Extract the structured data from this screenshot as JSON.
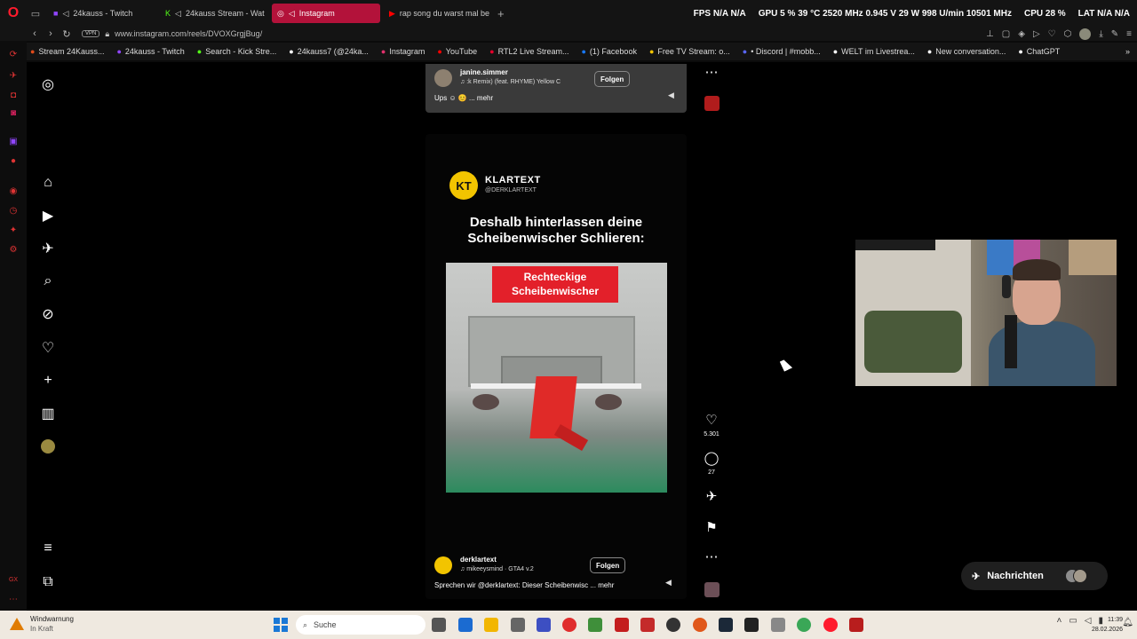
{
  "browser": {
    "tabs": [
      {
        "label": "24kauss - Twitch",
        "icon": "twitch-icon",
        "active": false
      },
      {
        "label": "24kauss Stream - Wat",
        "icon": "kick-icon",
        "active": false
      },
      {
        "label": "Instagram",
        "icon": "instagram-icon",
        "active": true
      },
      {
        "label": "rap song du warst mal be",
        "icon": "youtube-icon",
        "active": false
      }
    ],
    "hud": {
      "fps": "FPS  N/A  N/A",
      "gpu": "GPU  5 %  39 °C  2520 MHz  0.945 V  29 W  998 U/min  10501 MHz",
      "cpu": "CPU  28 %",
      "lat": "LAT  N/A  N/A"
    },
    "url": "www.instagram.com/reels/DVOXGrgjBug/",
    "vpn_label": "VPN",
    "bookmarks": [
      {
        "label": "Stream 24Kauss...",
        "icon": "bookmark-stream-icon",
        "color": "#e04a1a"
      },
      {
        "label": "24kauss - Twitch",
        "icon": "twitch-icon",
        "color": "#9146ff"
      },
      {
        "label": "Search - Kick Stre...",
        "icon": "kick-icon",
        "color": "#53fc18"
      },
      {
        "label": "24kauss7 (@24ka...",
        "icon": "tiktok-icon",
        "color": "#ffffff"
      },
      {
        "label": "Instagram",
        "icon": "instagram-icon",
        "color": "#e1306c"
      },
      {
        "label": "YouTube",
        "icon": "youtube-icon",
        "color": "#ff0000"
      },
      {
        "label": "RTL2 Live Stream...",
        "icon": "rtl2-icon",
        "color": "#e4002b"
      },
      {
        "label": "(1) Facebook",
        "icon": "facebook-icon",
        "color": "#1877f2"
      },
      {
        "label": "Free TV Stream: o...",
        "icon": "freetv-icon",
        "color": "#f2c400"
      },
      {
        "label": "• Discord | #mobb...",
        "icon": "discord-icon",
        "color": "#5865f2"
      },
      {
        "label": "WELT im Livestrea...",
        "icon": "welt-icon",
        "color": "#ffffff"
      },
      {
        "label": "New conversation...",
        "icon": "chat-icon",
        "color": "#ffffff"
      },
      {
        "label": "ChatGPT",
        "icon": "chatgpt-icon",
        "color": "#ffffff"
      }
    ]
  },
  "reels": {
    "previous": {
      "username": "janine.simmer",
      "music": "♫  :k Remix) (feat. RHYME)  Yellow C",
      "caption": "Ups ☺ 😊 ... mehr",
      "follow_label": "Folgen"
    },
    "current": {
      "channel_name": "KLARTEXT",
      "channel_handle": "@DERKLARTEXT",
      "logo_text": "KT",
      "headline": "Deshalb hinterlassen deine Scheibenwischer Schlieren:",
      "video_label": "Rechteckige Scheibenwischer",
      "username": "derklartext",
      "music": "♫  mikeeysmind · GTA4 v.2",
      "caption": "Sprechen wir @derklartext: Dieser Scheibenwisc ... mehr",
      "follow_label": "Folgen",
      "likes": "5.301",
      "comments": "27"
    }
  },
  "messages": {
    "label": "Nachrichten"
  },
  "taskbar": {
    "weather_title": "Windwarnung",
    "weather_sub": "In Kraft",
    "search_placeholder": "Suche",
    "time": "11:39",
    "date": "28.02.2026"
  }
}
